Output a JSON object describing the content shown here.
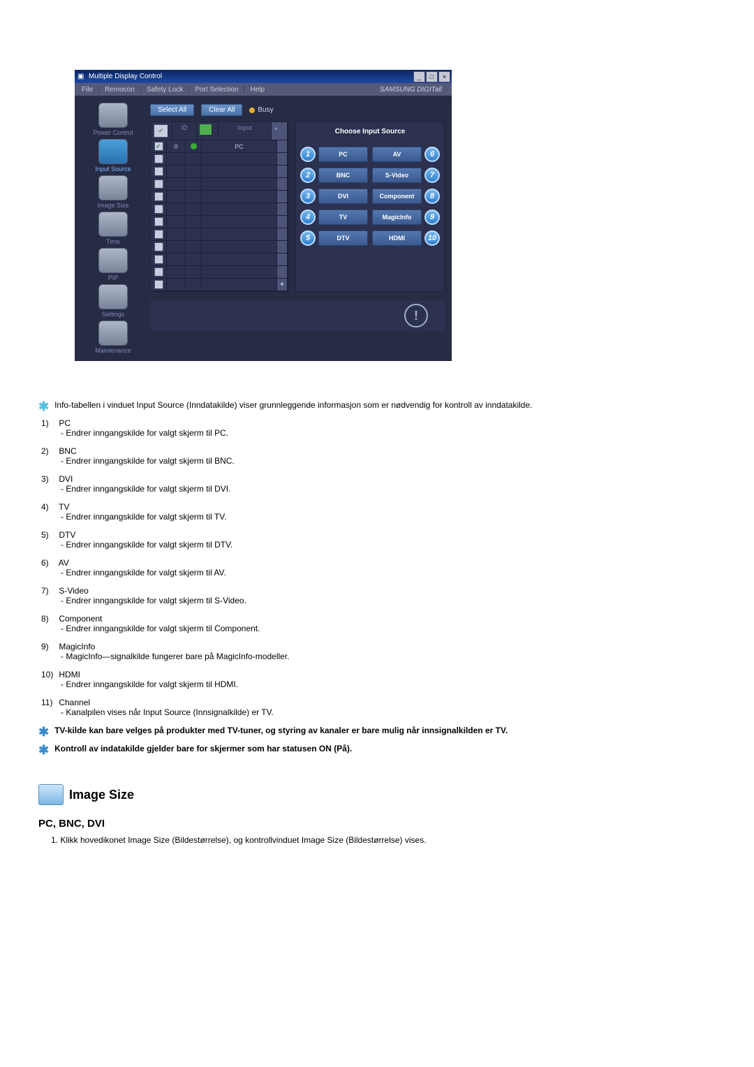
{
  "window": {
    "title": "Multiple Display Control"
  },
  "menu": {
    "file": "File",
    "remocon": "Remocon",
    "safety": "Safety Lock",
    "port": "Port Selection",
    "help": "Help",
    "brand": "SAMSUNG DIGITall"
  },
  "sidebar": {
    "items": [
      {
        "label": "Power Control"
      },
      {
        "label": "Input Source"
      },
      {
        "label": "Image Size"
      },
      {
        "label": "Time"
      },
      {
        "label": "PIP"
      },
      {
        "label": "Settings"
      },
      {
        "label": "Maintenance"
      }
    ]
  },
  "toolbar": {
    "select": "Select All",
    "clear": "Clear All",
    "busy": "Busy"
  },
  "grid": {
    "cols": {
      "chk": "☑",
      "id": "ID",
      "st": "",
      "input": "Input"
    },
    "row0": {
      "id": "0",
      "input": "PC"
    }
  },
  "source": {
    "title": "Choose Input Source",
    "left": [
      "PC",
      "BNC",
      "DVI",
      "TV",
      "DTV"
    ],
    "right": [
      "AV",
      "S-Video",
      "Component",
      "MagicInfo",
      "HDMI"
    ],
    "leftNums": [
      "1",
      "2",
      "3",
      "4",
      "5"
    ],
    "rightNums": [
      "6",
      "7",
      "8",
      "9",
      "10"
    ]
  },
  "doc": {
    "intro": "Info-tabellen i vinduet Input Source (Inndatakilde) viser grunnleggende informasjon som er nødvendig for kontroll av inndatakilde.",
    "items": [
      {
        "n": "1)",
        "t": "PC",
        "d": "- Endrer inngangskilde for valgt skjerm til PC."
      },
      {
        "n": "2)",
        "t": "BNC",
        "d": "- Endrer inngangskilde for valgt skjerm til BNC."
      },
      {
        "n": "3)",
        "t": "DVI",
        "d": "- Endrer inngangskilde for valgt skjerm til DVI."
      },
      {
        "n": "4)",
        "t": "TV",
        "d": "- Endrer inngangskilde for valgt skjerm til TV."
      },
      {
        "n": "5)",
        "t": "DTV",
        "d": "- Endrer inngangskilde for valgt skjerm til DTV."
      },
      {
        "n": "6)",
        "t": "AV",
        "d": "- Endrer inngangskilde for valgt skjerm til AV."
      },
      {
        "n": "7)",
        "t": "S-Video",
        "d": "- Endrer inngangskilde for valgt skjerm til S-Video."
      },
      {
        "n": "8)",
        "t": "Component",
        "d": "- Endrer inngangskilde for valgt skjerm til Component."
      },
      {
        "n": "9)",
        "t": "MagicInfo",
        "d": "- MagicInfo—signalkilde fungerer bare på MagicInfo-modeller."
      },
      {
        "n": "10)",
        "t": "HDMI",
        "d": "- Endrer inngangskilde for valgt skjerm til HDMI."
      },
      {
        "n": "11)",
        "t": "Channel",
        "d": "- Kanalpilen vises når Input Source (Innsignalkilde) er TV."
      }
    ],
    "note1": "TV-kilde kan bare velges på produkter med TV-tuner, og styring av kanaler er bare mulig når innsignalkilden er TV.",
    "note2": "Kontroll av indatakilde gjelder bare for skjermer som har statusen ON (På).",
    "section": "Image Size",
    "sub": "PC, BNC, DVI",
    "subList": "1.  Klikk hovedikonet Image Size (Bildestørrelse), og kontrollvinduet Image Size (Bildestørrelse) vises."
  }
}
